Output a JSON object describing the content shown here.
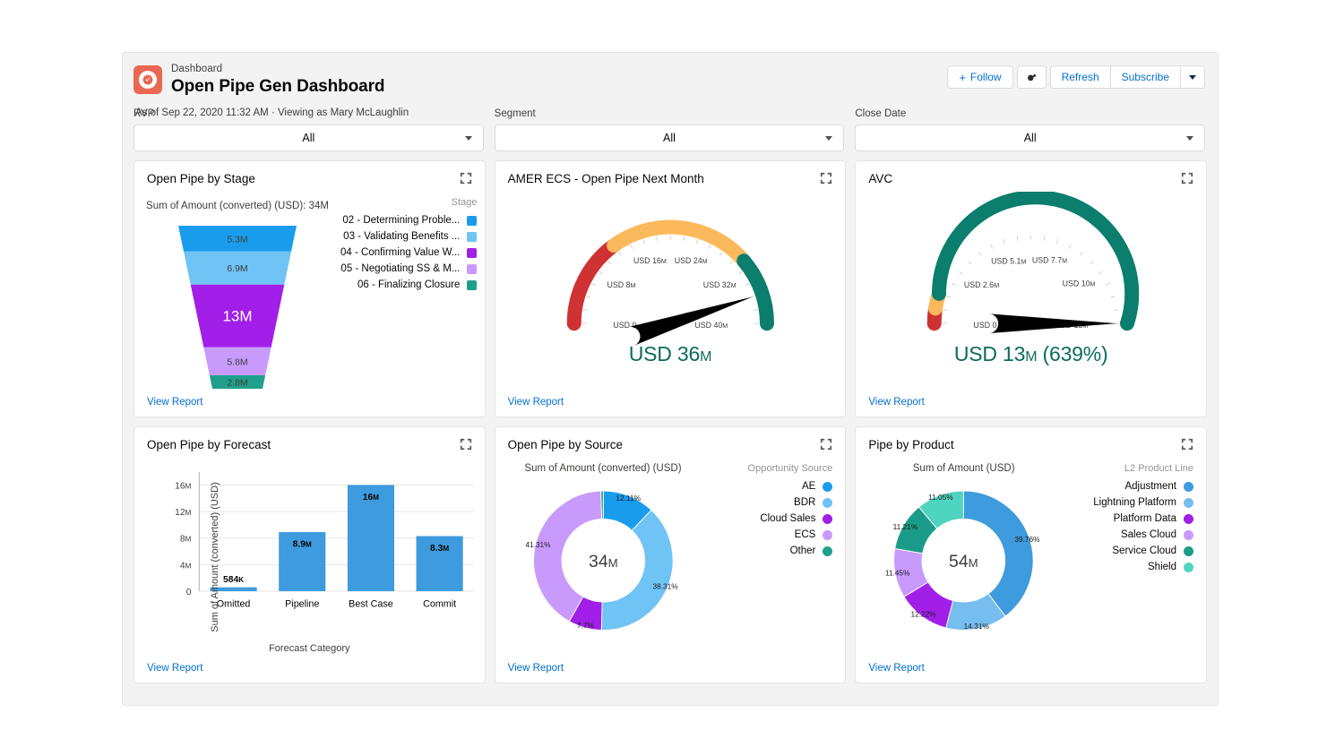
{
  "header": {
    "kicker": "Dashboard",
    "title": "Open Pipe Gen Dashboard",
    "subtitle": "As of Sep 22, 2020 11:32 AM · Viewing as Mary McLaughlin",
    "follow_label": "Follow",
    "refresh_label": "Refresh",
    "subscribe_label": "Subscribe"
  },
  "filters": [
    {
      "label": "RVP",
      "value": "All"
    },
    {
      "label": "Segment",
      "value": "All"
    },
    {
      "label": "Close Date",
      "value": "All"
    }
  ],
  "view_report_label": "View Report",
  "cards": {
    "funnel": {
      "title": "Open Pipe by Stage",
      "caption": "Sum of Amount (converted) (USD): 34M",
      "legend_title": "Stage"
    },
    "gauge1": {
      "title": "AMER ECS - Open Pipe Next Month",
      "value_prefix": "USD 36",
      "value_suffix": "M"
    },
    "gauge2": {
      "title": "AVC",
      "value_prefix": "USD 13",
      "value_suffix": "M",
      "value_tail": " (639%)"
    },
    "bar": {
      "title": "Open Pipe by Forecast"
    },
    "donut1": {
      "title": "Open Pipe by Source",
      "caption": "Sum of Amount (converted) (USD)",
      "legend_title": "Opportunity Source"
    },
    "donut2": {
      "title": "Pipe by Product",
      "caption": "Sum of Amount (USD)",
      "legend_title": "L2 Product Line"
    }
  },
  "chart_data": [
    {
      "type": "funnel",
      "title": "Open Pipe by Stage",
      "total_label": "34M",
      "categories": [
        "02 - Determining Proble...",
        "03 - Validating Benefits ...",
        "04 - Confirming Value W...",
        "05 - Negotiating SS & M...",
        "06 - Finalizing Closure"
      ],
      "values": [
        5.3,
        6.9,
        13,
        5.8,
        2.8
      ],
      "value_labels": [
        "5.3M",
        "6.9M",
        "13M",
        "5.8M",
        "2.8M"
      ],
      "colors": [
        "#1a9ced",
        "#6fc3f5",
        "#a11fe8",
        "#c89afc",
        "#20a08c"
      ]
    },
    {
      "type": "gauge",
      "title": "AMER ECS - Open Pipe Next Month",
      "value": 36,
      "min": 0,
      "max": 40,
      "value_text": "USD 36M",
      "tick_labels": [
        "USD 0",
        "USD 8M",
        "USD 16M",
        "USD 24M",
        "USD 32M",
        "USD 40M"
      ],
      "tick_values": [
        0,
        8,
        16,
        24,
        32,
        40
      ],
      "bands": [
        {
          "from": 0,
          "to": 12,
          "color": "#cf3232"
        },
        {
          "from": 12,
          "to": 31,
          "color": "#fcb95b"
        },
        {
          "from": 31,
          "to": 40,
          "color": "#0b7e6e"
        }
      ]
    },
    {
      "type": "gauge",
      "title": "AVC",
      "value": 13,
      "min": 0,
      "max": 13,
      "value_text": "USD 13M (639%)",
      "tick_labels": [
        "USD 0",
        "USD 2.6M",
        "USD 5.1M",
        "USD 7.7M",
        "USD 10M",
        "USD 13M"
      ],
      "tick_values": [
        0,
        2.6,
        5.1,
        7.7,
        10.3,
        13
      ],
      "bands": [
        {
          "from": 0,
          "to": 0.65,
          "color": "#cf3232"
        },
        {
          "from": 0.65,
          "to": 1.3,
          "color": "#fcb95b"
        },
        {
          "from": 1.3,
          "to": 13,
          "color": "#0b7e6e"
        }
      ]
    },
    {
      "type": "bar",
      "title": "Open Pipe by Forecast",
      "xlabel": "Forecast Category",
      "ylabel": "Sum of Amount (converted) (USD)",
      "categories": [
        "Omitted",
        "Pipeline",
        "Best Case",
        "Commit"
      ],
      "values": [
        0.584,
        8.9,
        16,
        8.3
      ],
      "value_labels": [
        "584K",
        "8.9M",
        "16M",
        "8.3M"
      ],
      "ytick_labels": [
        "0",
        "4M",
        "8M",
        "12M",
        "16M"
      ],
      "ytick_values": [
        0,
        4,
        8,
        12,
        16
      ],
      "ylim": [
        0,
        17.4
      ],
      "color": "#3e9bdd"
    },
    {
      "type": "pie",
      "title": "Open Pipe by Source",
      "center_label": "34M",
      "categories": [
        "AE",
        "BDR",
        "Cloud Sales",
        "ECS",
        "Other"
      ],
      "values": [
        12.11,
        38.31,
        7.7,
        41.31,
        0.57
      ],
      "value_labels": [
        "12.11%",
        "38.31%",
        "7.7%",
        "41.31%",
        ""
      ],
      "colors": [
        "#1a9ced",
        "#6fc3f5",
        "#a11fe8",
        "#c89afc",
        "#20a08c"
      ]
    },
    {
      "type": "pie",
      "title": "Pipe by Product",
      "center_label": "54M",
      "categories": [
        "Adjustment",
        "Lightning Platform",
        "Platform Data",
        "Sales Cloud",
        "Service Cloud",
        "Shield"
      ],
      "values": [
        39.76,
        14.31,
        12.22,
        11.45,
        11.21,
        11.05
      ],
      "value_labels": [
        "39.76%",
        "14.31%",
        "12.22%",
        "11.45%",
        "11.21%",
        "11.05%"
      ],
      "colors": [
        "#3e9bdd",
        "#76bdf0",
        "#a11fe8",
        "#c89afc",
        "#1a9c88",
        "#4fd4c0"
      ]
    }
  ]
}
